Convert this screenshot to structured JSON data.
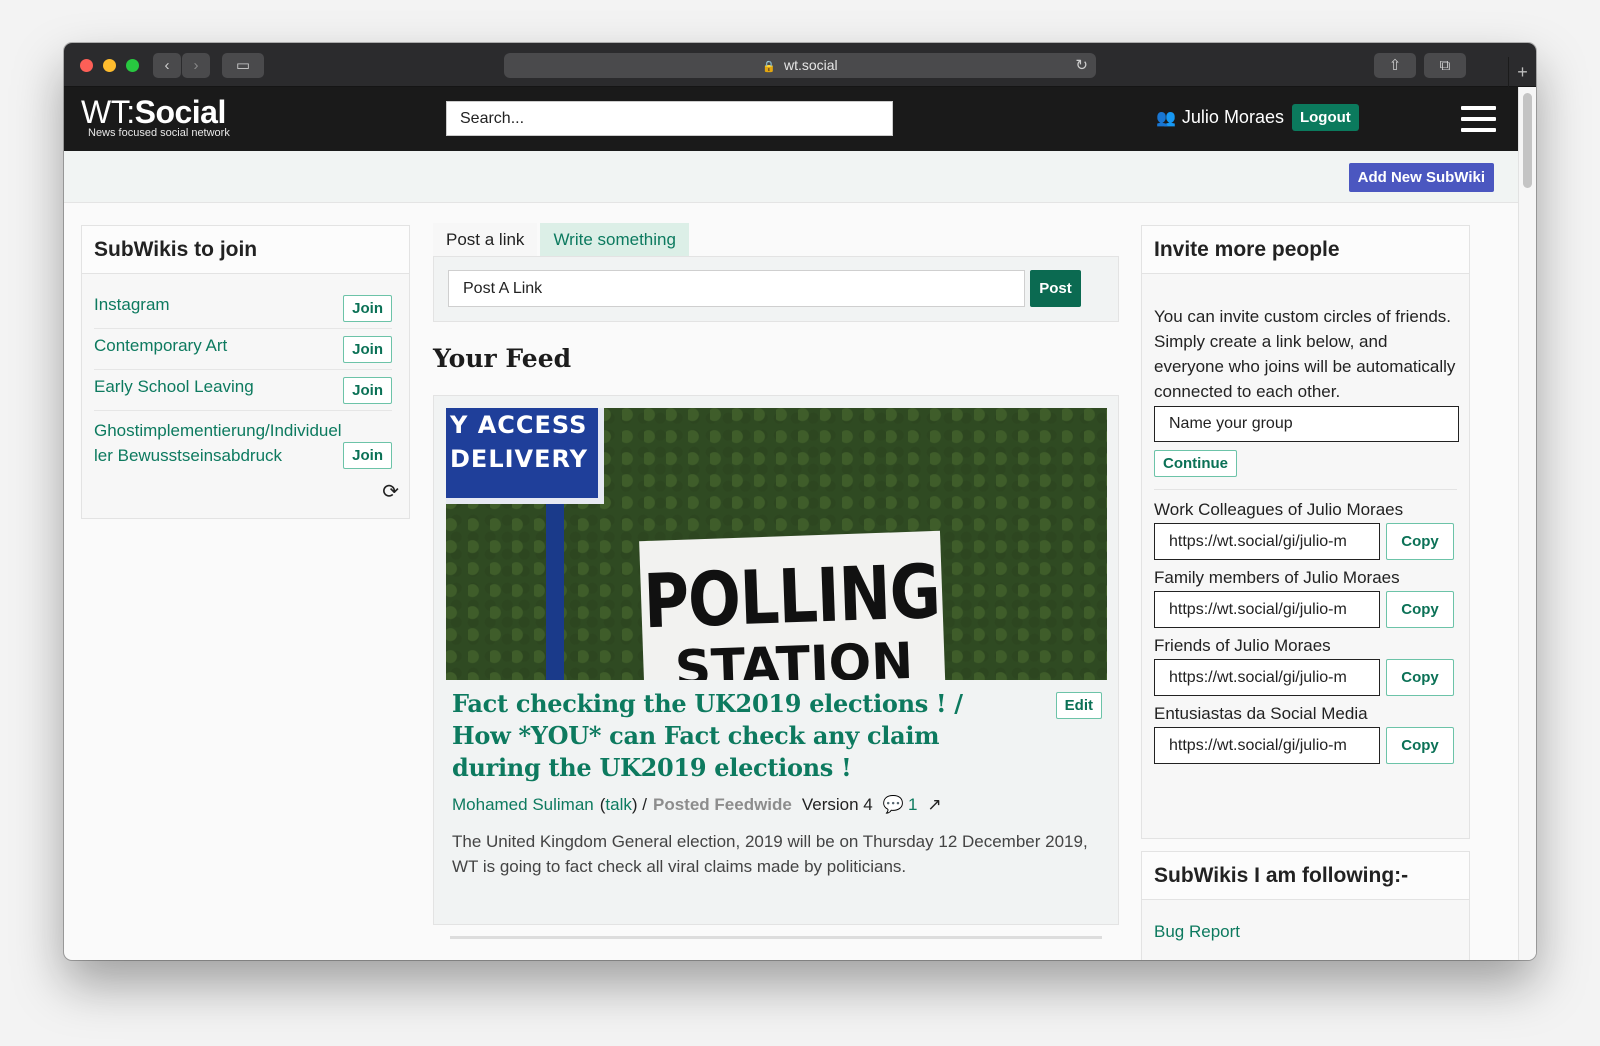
{
  "browser": {
    "url": "wt.social",
    "back": "‹",
    "forward": "›",
    "sidebar": "▭",
    "share": "⇧",
    "tabs": "⧉",
    "new_tab": "+",
    "reload": "↻",
    "lock": "🔒"
  },
  "nav": {
    "logo_wt": "WT:",
    "logo_social": "Social",
    "logo_tagline": "News focused social network",
    "search_placeholder": "Search...",
    "user_name": "Julio Moraes",
    "logout_label": "Logout",
    "user_icon": "👥"
  },
  "subbar": {
    "add_subwiki_label": "Add New SubWiki"
  },
  "left": {
    "title": "SubWikis to join",
    "join_label": "Join",
    "items": [
      {
        "name": "Instagram"
      },
      {
        "name": "Contemporary Art"
      },
      {
        "name": "Early School Leaving"
      },
      {
        "name": "Ghostimplementierung/Individueller Bewusstseinsabdruck"
      }
    ],
    "refresh_icon": "⟳"
  },
  "composer": {
    "tab_link": "Post a link",
    "tab_write": "Write something",
    "input_placeholder": "Post A Link",
    "post_label": "Post"
  },
  "feed": {
    "title": "Your Feed",
    "image_sign_blue": "Y ACCESS DELIVERY",
    "image_sign_white_1": "POLLING",
    "image_sign_white_2": "STATION",
    "article": {
      "title": "Fact checking the UK2019 elections ! / How *YOU* can Fact check any claim during the UK2019 elections !",
      "edit_label": "Edit",
      "author": "Mohamed Suliman",
      "talk": "talk",
      "posted": "Posted Feedwide",
      "version": "Version 4",
      "comment_icon": "💬",
      "comments": "1",
      "share_icon": "↗",
      "summary": "The United Kingdom General election, 2019  will be on Thursday 12 December 2019, WT is going to fact check all viral claims made by politicians."
    }
  },
  "invite": {
    "title": "Invite more people",
    "text": "You can invite custom circles of friends. Simply create a link below, and everyone who joins will be automatically connected to each other.",
    "group_placeholder": "Name your group",
    "continue_label": "Continue",
    "copy_label": "Copy",
    "circles": [
      {
        "label": "Work Colleagues of Julio Moraes",
        "url": "https://wt.social/gi/julio-m"
      },
      {
        "label": "Family members of Julio Moraes",
        "url": "https://wt.social/gi/julio-m"
      },
      {
        "label": "Friends of Julio Moraes",
        "url": "https://wt.social/gi/julio-m"
      },
      {
        "label": "Entusiastas da Social Media",
        "url": "https://wt.social/gi/julio-m"
      }
    ]
  },
  "following": {
    "title": "SubWikis I am following:-",
    "items": [
      {
        "name": "Bug Report"
      }
    ]
  }
}
